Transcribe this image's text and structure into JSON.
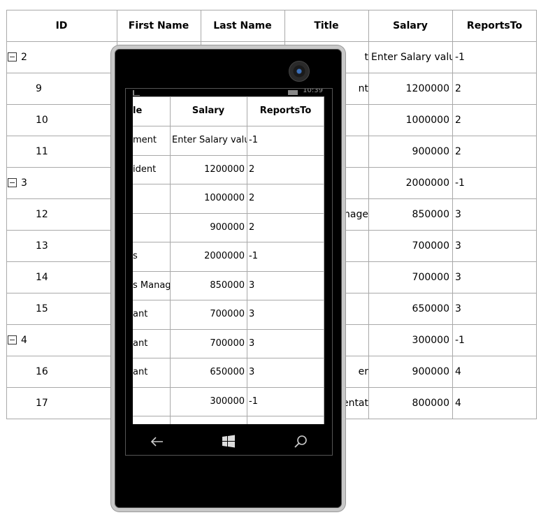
{
  "grid": {
    "columns": [
      "ID",
      "First Name",
      "Last Name",
      "Title",
      "Salary",
      "ReportsTo"
    ],
    "rows": [
      {
        "group": true,
        "id": "2",
        "title": "t",
        "salary": "Enter Salary value",
        "reports": "-1"
      },
      {
        "group": false,
        "id": "9",
        "title": "nt",
        "salary": "1200000",
        "reports": "2"
      },
      {
        "group": false,
        "id": "10",
        "title": "",
        "salary": "1000000",
        "reports": "2"
      },
      {
        "group": false,
        "id": "11",
        "title": "",
        "salary": "900000",
        "reports": "2"
      },
      {
        "group": true,
        "id": "3",
        "title": "",
        "salary": "2000000",
        "reports": "-1"
      },
      {
        "group": false,
        "id": "12",
        "title": "anage",
        "salary": "850000",
        "reports": "3"
      },
      {
        "group": false,
        "id": "13",
        "title": "",
        "salary": "700000",
        "reports": "3"
      },
      {
        "group": false,
        "id": "14",
        "title": "",
        "salary": "700000",
        "reports": "3"
      },
      {
        "group": false,
        "id": "15",
        "title": "",
        "salary": "650000",
        "reports": "3"
      },
      {
        "group": true,
        "id": "4",
        "title": "",
        "salary": "300000",
        "reports": "-1"
      },
      {
        "group": false,
        "id": "16",
        "title": "er",
        "salary": "900000",
        "reports": "4"
      },
      {
        "group": false,
        "id": "17",
        "title": "entat",
        "salary": "800000",
        "reports": "4"
      }
    ]
  },
  "phone": {
    "status_time": "10:39",
    "columns": [
      "le",
      "Salary",
      "ReportsTo"
    ],
    "rows": [
      {
        "title": "ment",
        "salary": "Enter Salary value",
        "reports": "-1"
      },
      {
        "title": "ident",
        "salary": "1200000",
        "reports": "2"
      },
      {
        "title": "",
        "salary": "1000000",
        "reports": "2"
      },
      {
        "title": "",
        "salary": "900000",
        "reports": "2"
      },
      {
        "title": "s",
        "salary": "2000000",
        "reports": "-1"
      },
      {
        "title": "s Manage",
        "salary": "850000",
        "reports": "3"
      },
      {
        "title": "ant",
        "salary": "700000",
        "reports": "3"
      },
      {
        "title": "ant",
        "salary": "700000",
        "reports": "3"
      },
      {
        "title": "ant",
        "salary": "650000",
        "reports": "3"
      },
      {
        "title": "",
        "salary": "300000",
        "reports": "-1"
      }
    ],
    "nav_icons": [
      "back-arrow-icon",
      "windows-start-icon",
      "search-icon"
    ]
  }
}
